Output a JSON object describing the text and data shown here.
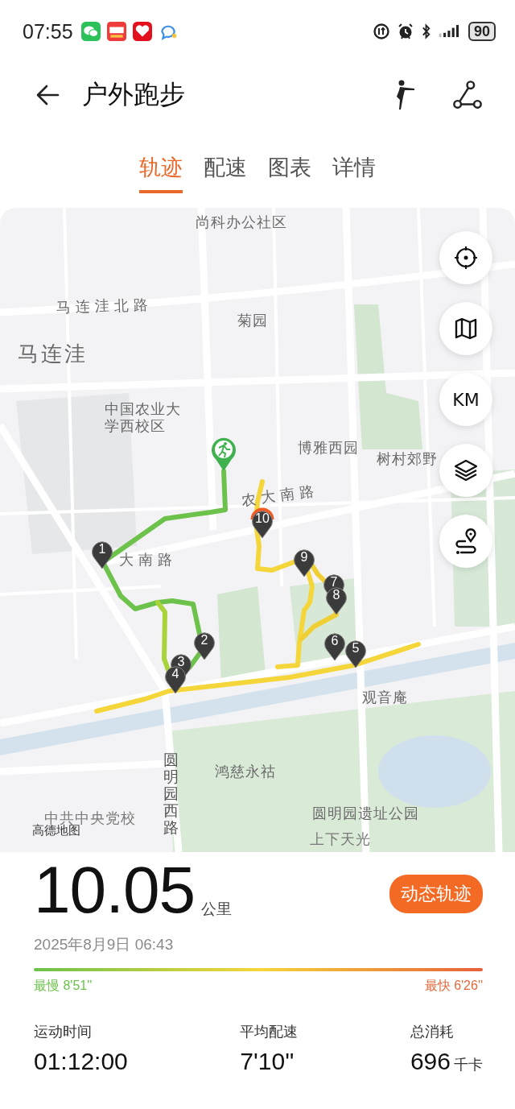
{
  "status_bar": {
    "time": "07:55",
    "battery": "90"
  },
  "header": {
    "title": "户外跑步"
  },
  "tabs": [
    {
      "label": "轨迹",
      "selected": true
    },
    {
      "label": "配速",
      "selected": false
    },
    {
      "label": "图表",
      "selected": false
    },
    {
      "label": "详情",
      "selected": false
    }
  ],
  "map": {
    "labels": [
      {
        "text": "尚科办公社区",
        "kind": "area"
      },
      {
        "text": "马连洼北路",
        "kind": "road"
      },
      {
        "text": "菊园",
        "kind": "area"
      },
      {
        "text": "马连洼",
        "kind": "district"
      },
      {
        "text": "中国农业大学西校区",
        "kind": "area"
      },
      {
        "text": "博雅西园",
        "kind": "area"
      },
      {
        "text": "树村郊野",
        "kind": "area"
      },
      {
        "text": "农大南路",
        "kind": "road"
      },
      {
        "text": "大南路",
        "kind": "road"
      },
      {
        "text": "观音庵",
        "kind": "area"
      },
      {
        "text": "鸿慈永祜",
        "kind": "area"
      },
      {
        "text": "圆明园西路",
        "kind": "vertical"
      },
      {
        "text": "中共中央党校",
        "kind": "faint"
      },
      {
        "text": "高德地图",
        "kind": "credit"
      },
      {
        "text": "圆明园遗址公园",
        "kind": "area"
      },
      {
        "text": "上下天光",
        "kind": "faint"
      }
    ],
    "km_markers": [
      {
        "label": "1",
        "kind": "km"
      },
      {
        "label": "2",
        "kind": "km"
      },
      {
        "label": "3",
        "kind": "km"
      },
      {
        "label": "4",
        "kind": "km"
      },
      {
        "label": "7",
        "kind": "km"
      },
      {
        "label": "8",
        "kind": "km"
      },
      {
        "label": "6",
        "kind": "km"
      },
      {
        "label": "5",
        "kind": "km"
      },
      {
        "label": "9",
        "kind": "km"
      },
      {
        "label": "10",
        "kind": "finish"
      }
    ],
    "controls": [
      {
        "kind": "locate"
      },
      {
        "kind": "map"
      },
      {
        "kind": "unit",
        "label": "KM"
      },
      {
        "kind": "layers"
      },
      {
        "kind": "route"
      }
    ]
  },
  "summary": {
    "distance": "10.05",
    "unit": "公里",
    "replay_button": "动态轨迹",
    "date": "2025年8月9日 06:43",
    "slowest": {
      "label": "最慢",
      "value": "8'51''"
    },
    "fastest": {
      "label": "最快",
      "value": "6'26''"
    },
    "stats": [
      {
        "label": "运动时间",
        "value": "01:12:00"
      },
      {
        "label": "平均配速",
        "value": "7'10''"
      },
      {
        "label": "总消耗",
        "value": "696",
        "unit": "千卡"
      }
    ]
  }
}
